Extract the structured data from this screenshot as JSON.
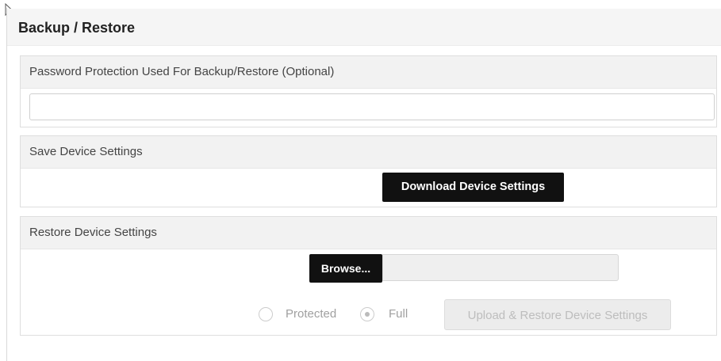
{
  "page_title": "Backup / Restore",
  "password_section": {
    "label": "Password Protection Used For Backup/Restore (Optional)",
    "value": ""
  },
  "save_section": {
    "label": "Save Device Settings",
    "download_button": "Download Device Settings"
  },
  "restore_section": {
    "label": "Restore Device Settings",
    "browse_button": "Browse...",
    "file_value": "",
    "radio_protected": "Protected",
    "radio_full": "Full",
    "selected_mode": "Full",
    "upload_button": "Upload & Restore Device Settings"
  },
  "icons": {
    "cursor": "mouse-pointer-icon"
  },
  "colors": {
    "dark_button": "#111111",
    "disabled_text": "#bdbdbd"
  }
}
